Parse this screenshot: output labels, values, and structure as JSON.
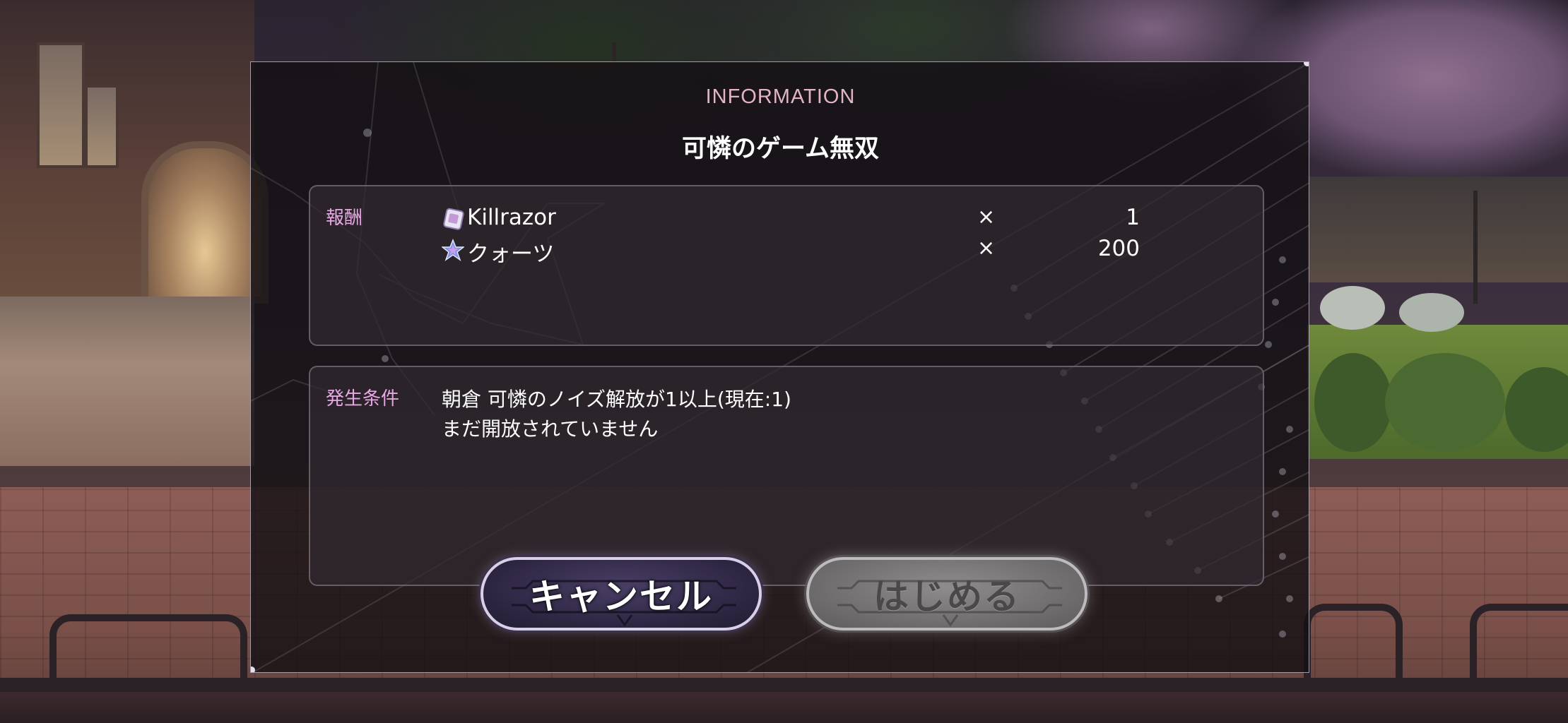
{
  "dialog": {
    "heading": "INFORMATION",
    "title": "可憐のゲーム無双"
  },
  "rewards": {
    "label": "報酬",
    "items": [
      {
        "icon": "card-ticket-icon",
        "name": "Killrazor",
        "times": "×",
        "quantity": "1"
      },
      {
        "icon": "quartz-star-icon",
        "name": "クォーツ",
        "times": "×",
        "quantity": "200"
      }
    ]
  },
  "conditions": {
    "label": "発生条件",
    "lines": [
      "朝倉 可憐のノイズ解放が1以上(現在:1)",
      "まだ開放されていません"
    ]
  },
  "buttons": {
    "cancel": "キャンセル",
    "start": "はじめる"
  },
  "colors": {
    "heading": "#e2b4c6",
    "label": "#e7a7e4",
    "cancel_button": "#2c2540",
    "start_button_disabled": "#6c6a6b"
  },
  "state": {
    "start_button_enabled": false
  }
}
